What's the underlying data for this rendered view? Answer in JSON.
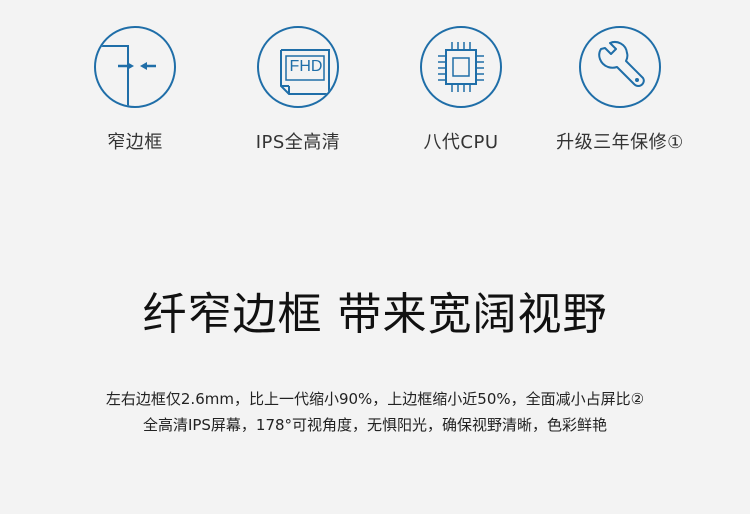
{
  "features": [
    {
      "label": "窄边框",
      "icon": "narrow-bezel-icon"
    },
    {
      "label": "IPS全高清",
      "icon": "fhd-display-icon",
      "icon_text": "FHD"
    },
    {
      "label": "八代CPU",
      "icon": "cpu-chip-icon"
    },
    {
      "label": "升级三年保修①",
      "icon": "wrench-icon"
    }
  ],
  "headline": "纤窄边框 带来宽阔视野",
  "description": {
    "line1": "左右边框仅2.6mm，比上一代缩小90%，上边框缩小近50%，全面减小占屏比②",
    "line2": "全高清IPS屏幕，178°可视角度，无惧阳光，确保视野清晰，色彩鲜艳"
  },
  "colors": {
    "accent": "#1f6ea8",
    "background": "#f3f3f3",
    "text": "#222222"
  }
}
